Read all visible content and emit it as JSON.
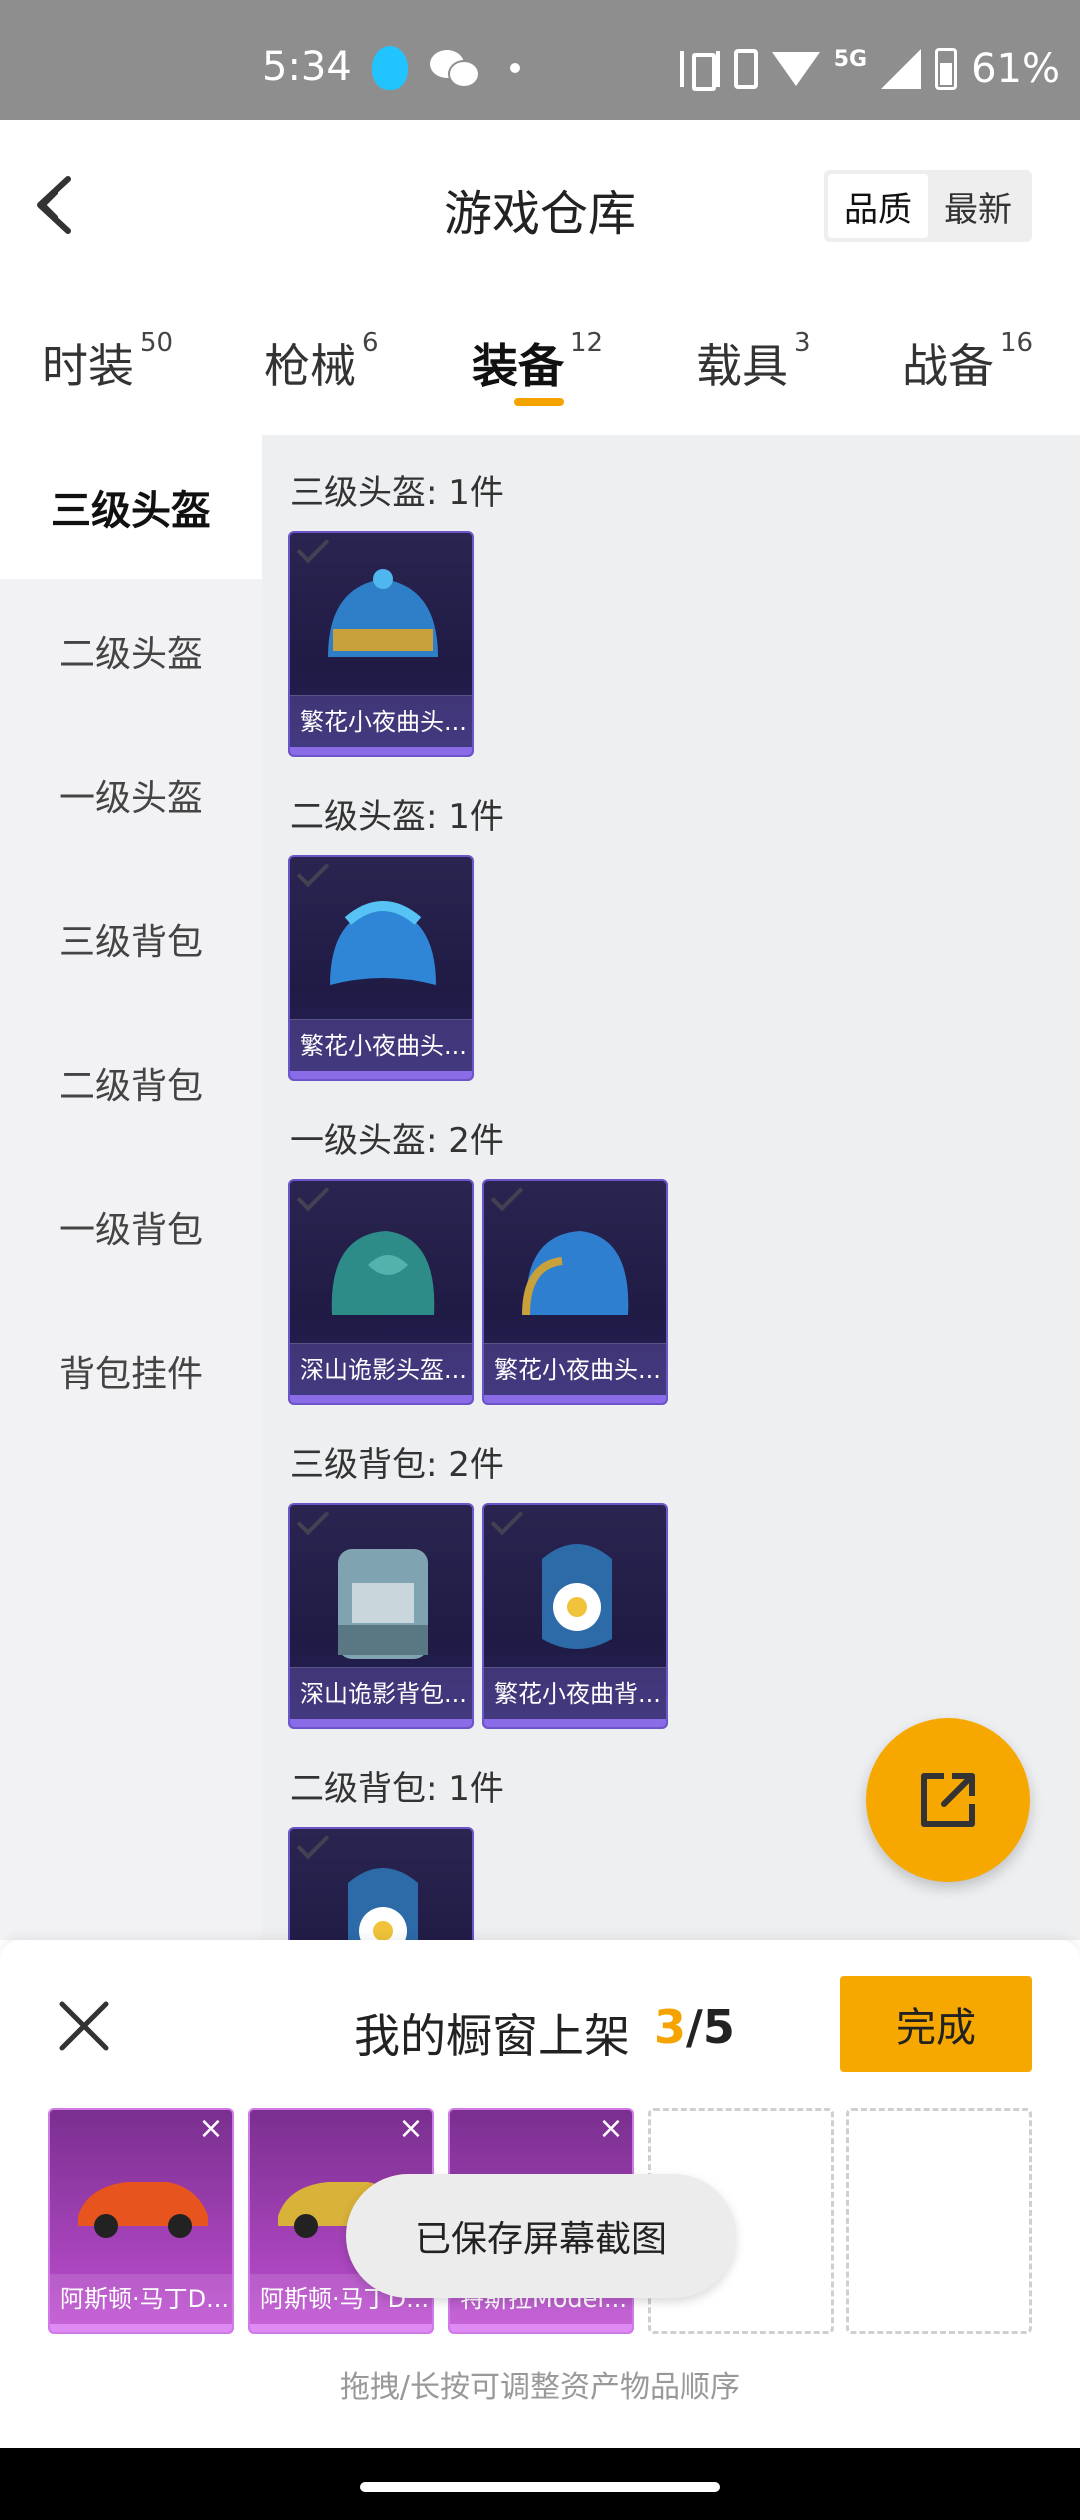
{
  "status_bar": {
    "time": "5:34",
    "network": "5G",
    "battery": "61%"
  },
  "header": {
    "title": "游戏仓库",
    "sort_options": [
      "品质",
      "最新"
    ],
    "sort_active": "品质"
  },
  "tabs": [
    {
      "label": "时装",
      "count": "50"
    },
    {
      "label": "枪械",
      "count": "6"
    },
    {
      "label": "装备",
      "count": "12"
    },
    {
      "label": "载具",
      "count": "3"
    },
    {
      "label": "战备",
      "count": "16"
    }
  ],
  "sidebar": {
    "items": [
      "三级头盔",
      "二级头盔",
      "一级头盔",
      "三级背包",
      "二级背包",
      "一级背包",
      "背包挂件"
    ],
    "active": "三级头盔"
  },
  "sections": [
    {
      "title": "三级头盔: 1件",
      "items": [
        "繁花小夜曲头..."
      ]
    },
    {
      "title": "二级头盔: 1件",
      "items": [
        "繁花小夜曲头..."
      ]
    },
    {
      "title": "一级头盔: 2件",
      "items": [
        "深山诡影头盔...",
        "繁花小夜曲头..."
      ]
    },
    {
      "title": "三级背包: 2件",
      "items": [
        "深山诡影背包...",
        "繁花小夜曲背..."
      ]
    },
    {
      "title": "二级背包: 1件",
      "items": [
        ""
      ]
    }
  ],
  "panel": {
    "title": "我的橱窗上架",
    "current": "3",
    "total": "/5",
    "done_label": "完成",
    "slots": [
      "阿斯顿·马丁D...",
      "阿斯顿·马丁D...",
      "特斯拉Model..."
    ],
    "hint": "拖拽/长按可调整资产物品顺序"
  },
  "toast": "已保存屏幕截图",
  "colors": {
    "accent": "#f7a800",
    "card_purple": "#6b55c9",
    "slot_purple": "#c04fd3"
  }
}
